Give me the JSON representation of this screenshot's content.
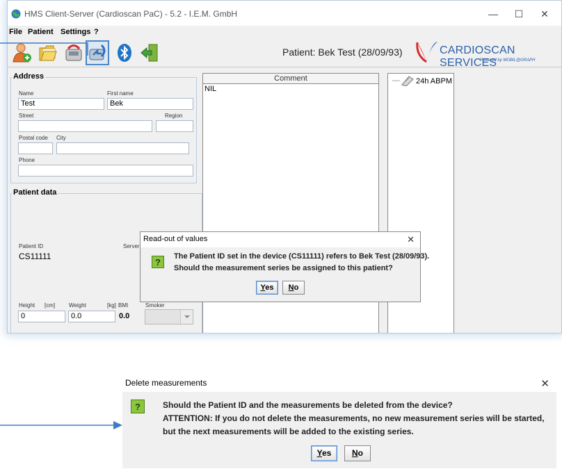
{
  "window": {
    "title": "HMS Client-Server (Cardioscan PaC) - 5.2 - I.E.M. GmbH",
    "controls": {
      "minimize": "—",
      "maximize": "☐",
      "close": "✕"
    }
  },
  "menu": [
    "File",
    "Patient",
    "Settings",
    "?"
  ],
  "toolbar": {
    "buttons": [
      {
        "icon": "add-patient-icon"
      },
      {
        "icon": "open-folder-icon"
      },
      {
        "icon": "device-programming-icon"
      },
      {
        "icon": "device-readout-icon",
        "active": true
      },
      {
        "icon": "bluetooth-icon"
      },
      {
        "icon": "exit-icon"
      }
    ],
    "patient_label": "Patient: Bek Test (28/09/93)",
    "logo_text": "CARDIOSCAN SERVICES",
    "logo_sub": "Powered by MOBIL@GRAPH"
  },
  "address": {
    "title": "Address",
    "name_label": "Name",
    "name_value": "Test",
    "firstname_label": "First name",
    "firstname_value": "Bek",
    "street_label": "Street",
    "street_value": "",
    "region_label": "Region",
    "region_value": "",
    "postal_label": "Postal code",
    "postal_value": "",
    "city_label": "City",
    "city_value": "",
    "phone_label": "Phone",
    "phone_value": ""
  },
  "patient_data": {
    "title": "Patient data",
    "id_label": "Patient ID",
    "id_value": "CS11111",
    "server_label": "Server",
    "height_label": "Height",
    "height_unit": "[cm]",
    "height_value": "0",
    "weight_label": "Weight",
    "weight_unit": "[kg]",
    "weight_value": "0.0",
    "bmi_label": "BMI",
    "bmi_value": "0.0",
    "smoker_label": "Smoker"
  },
  "comment": {
    "header": "Comment",
    "value": "NIL"
  },
  "tree": {
    "item": "24h ABPM"
  },
  "dialog1": {
    "title": "Read-out of values",
    "close": "✕",
    "icon": "?",
    "line1": "The Patient ID set in the device (CS11111) refers to Bek Test (28/09/93).",
    "line2": "Should the measurement series be assigned to this patient?",
    "yes": "Yes",
    "no": "No"
  },
  "dialog2": {
    "title": "Delete measurements",
    "close": "✕",
    "icon": "?",
    "line1": "Should the Patient ID and the measurements be deleted from the device?",
    "line2": "ATTENTION: If you do not delete the measurements, no new measurement series will be started,",
    "line3": "but the next measurements will be added to the existing series.",
    "yes": "Yes",
    "no": "No"
  },
  "colors": {
    "accent": "#4a86c8",
    "arrow": "#3d7cc9",
    "question_icon": "#8cc63f",
    "logo": "#2b5fa8"
  }
}
